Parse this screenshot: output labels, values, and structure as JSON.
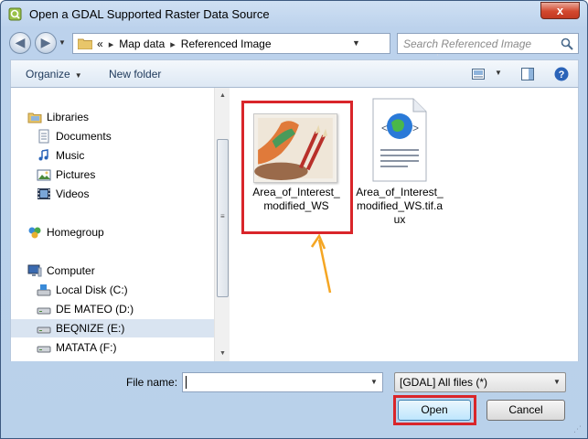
{
  "window": {
    "title": "Open a GDAL Supported Raster Data Source",
    "close_label": "x"
  },
  "address_bar": {
    "prefix": "«",
    "crumbs": [
      "Map data",
      "Referenced Image"
    ],
    "separator": "▸"
  },
  "search": {
    "placeholder": "Search Referenced Image"
  },
  "toolbar": {
    "organize_label": "Organize",
    "new_folder_label": "New folder"
  },
  "nav_pane": {
    "items": [
      {
        "label": "Libraries",
        "icon": "libraries-icon"
      },
      {
        "label": "Documents",
        "icon": "documents-icon"
      },
      {
        "label": "Music",
        "icon": "music-icon"
      },
      {
        "label": "Pictures",
        "icon": "pictures-icon"
      },
      {
        "label": "Videos",
        "icon": "videos-icon"
      },
      {
        "label": "Homegroup",
        "icon": "homegroup-icon"
      },
      {
        "label": "Computer",
        "icon": "computer-icon"
      },
      {
        "label": "Local Disk (C:)",
        "icon": "local-disk-icon"
      },
      {
        "label": "DE MATEO (D:)",
        "icon": "drive-icon"
      },
      {
        "label": "BEQNIZE (E:)",
        "icon": "drive-icon",
        "selected": true
      },
      {
        "label": "MATATA (F:)",
        "icon": "drive-icon"
      }
    ]
  },
  "files": [
    {
      "name_line1": "Area_of_Interest_",
      "name_line2": "modified_WS",
      "icon": "image-thumbnail-icon",
      "highlighted": true
    },
    {
      "name_line1": "Area_of_Interest_",
      "name_line2": "modified_WS.tif.a",
      "name_line3": "ux",
      "icon": "xml-document-icon"
    }
  ],
  "bottom": {
    "file_name_label": "File name:",
    "file_name_value": "",
    "filter_value": "[GDAL] All files (*)",
    "open_label": "Open",
    "cancel_label": "Cancel"
  },
  "colors": {
    "annotation_red": "#d9252a",
    "annotation_arrow": "#f5a623",
    "selected_bg": "#d9e4f1"
  }
}
